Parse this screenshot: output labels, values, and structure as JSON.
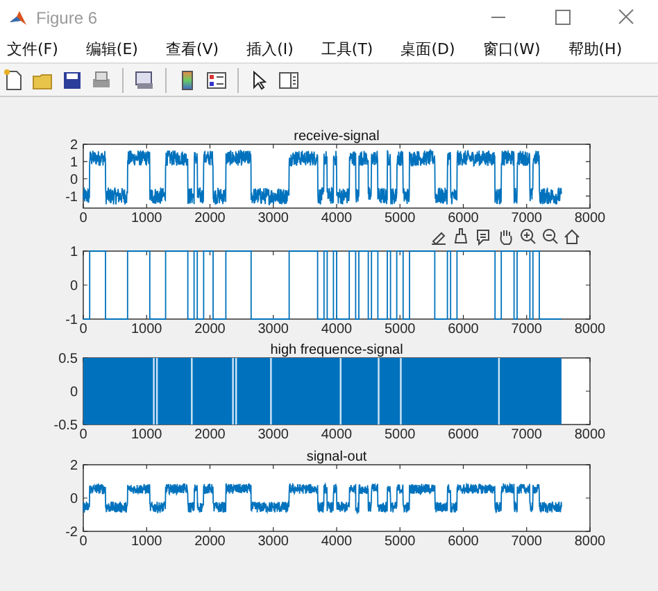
{
  "window": {
    "title": "Figure 6"
  },
  "menu": [
    {
      "label": "文件(F)"
    },
    {
      "label": "编辑(E)"
    },
    {
      "label": "查看(V)"
    },
    {
      "label": "插入(I)"
    },
    {
      "label": "工具(T)"
    },
    {
      "label": "桌面(D)"
    },
    {
      "label": "窗口(W)"
    },
    {
      "label": "帮助(H)"
    }
  ],
  "axes": [
    {
      "kind": "noisy",
      "title": "receive-signal",
      "xticks": [
        "0",
        "1000",
        "2000",
        "3000",
        "4000",
        "5000",
        "6000",
        "7000",
        "8000"
      ],
      "yticks": [
        "2",
        "1",
        "0",
        "-1"
      ]
    },
    {
      "kind": "square",
      "xticks": [
        "0",
        "1000",
        "2000",
        "3000",
        "4000",
        "5000",
        "6000",
        "7000",
        "8000"
      ],
      "yticks": [
        "1",
        "0",
        "-1"
      ]
    },
    {
      "kind": "carrier",
      "title": "high frequence-signal",
      "xticks": [
        "0",
        "1000",
        "2000",
        "3000",
        "4000",
        "5000",
        "6000",
        "7000",
        "8000"
      ],
      "yticks": [
        "0.5",
        "0",
        "-0.5"
      ]
    },
    {
      "kind": "filtered",
      "title": "signal-out",
      "xticks": [
        "0",
        "1000",
        "2000",
        "3000",
        "4000",
        "5000",
        "6000",
        "7000",
        "8000"
      ],
      "yticks": [
        "2",
        "0",
        "-2"
      ]
    }
  ]
}
